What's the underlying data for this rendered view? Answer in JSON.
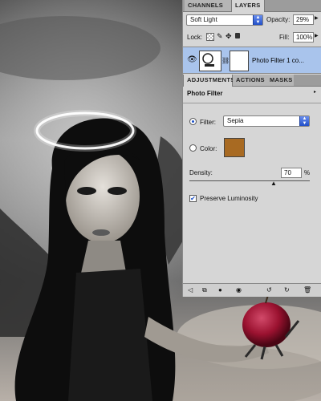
{
  "colors": {
    "panel_bg": "#d6d6d6",
    "tab_bar": "#9c9c9c",
    "selected_layer": "#a9c4ec",
    "photo_filter_color": "#a86a22",
    "apple_red": "#9b1230"
  },
  "tabs": {
    "top": [
      "CHANNELS",
      "LAYERS"
    ],
    "bottom": [
      "ADJUSTMENTS",
      "ACTIONS",
      "MASKS"
    ]
  },
  "layers": {
    "blend_mode": "Soft Light",
    "opacity_label": "Opacity:",
    "opacity_value": "29%",
    "lock_label": "Lock:",
    "fill_label": "Fill:",
    "fill_value": "100%",
    "layer_name": "Photo Filter 1 co..."
  },
  "adjustments": {
    "title": "Photo Filter",
    "filter_label": "Filter:",
    "filter_value": "Sepia",
    "color_label": "Color:",
    "density_label": "Density:",
    "density_value": "70",
    "density_unit": "%",
    "density_level": 0.7,
    "preserve_label": "Preserve Luminosity",
    "preserve_checked": true
  },
  "icons": [
    "eye-icon",
    "lock-transparency-icon",
    "lock-brush-icon",
    "lock-move-icon",
    "lock-all-icon",
    "back-arrow-icon",
    "clip-layer-icon",
    "visibility-icon",
    "view-previous-icon",
    "reset-icon",
    "delete-icon"
  ]
}
